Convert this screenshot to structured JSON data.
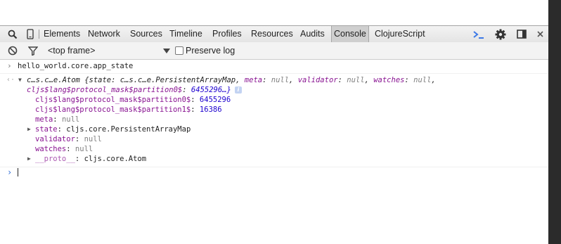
{
  "toolbar": {
    "tabs": [
      "Elements",
      "Network",
      "Sources",
      "Timeline",
      "Profiles",
      "Resources",
      "Audits",
      "Console",
      "ClojureScript"
    ],
    "selected_tab": "Console"
  },
  "filterbar": {
    "frame_selector": "<top frame>",
    "preserve_log_label": "Preserve log",
    "preserve_log_checked": false
  },
  "console": {
    "command": "hello_world.core.app_state",
    "result": {
      "summary_type": "c…s.c…e.Atom ",
      "summary_open": "{state: ",
      "summary_state_type": "c…s.c…e.PersistentArrayMap",
      "summary_meta_key": "meta",
      "summary_meta_val": "null",
      "summary_validator_key": "validator",
      "summary_validator_val": "null",
      "summary_watches_key": "watches",
      "summary_watches_val": "null",
      "summary_mask_key": "cljs$lang$protocol_mask$partition0$",
      "summary_mask_val": "6455296…}",
      "info_icon": "i",
      "props": [
        {
          "key": "cljs$lang$protocol_mask$partition0$",
          "value": "6455296",
          "value_kind": "number",
          "expandable": false
        },
        {
          "key": "cljs$lang$protocol_mask$partition1$",
          "value": "16386",
          "value_kind": "number",
          "expandable": false
        },
        {
          "key": "meta",
          "value": "null",
          "value_kind": "null",
          "expandable": false
        },
        {
          "key": "state",
          "value": "cljs.core.PersistentArrayMap",
          "value_kind": "object",
          "expandable": true
        },
        {
          "key": "validator",
          "value": "null",
          "value_kind": "null",
          "expandable": false
        },
        {
          "key": "watches",
          "value": "null",
          "value_kind": "null",
          "expandable": false
        },
        {
          "key": "__proto__",
          "value": "cljs.core.Atom",
          "value_kind": "object",
          "expandable": true
        }
      ]
    }
  },
  "colors": {
    "property_key": "#881391",
    "number": "#1c00cf",
    "null": "#808080",
    "prompt": "#2f6dd6",
    "dock_accent": "#3b78e7"
  },
  "icons": {
    "toolbar": [
      "search-icon",
      "device-mode-icon",
      "console-drawer-icon",
      "settings-gear-icon",
      "dock-side-icon",
      "close-icon"
    ],
    "filterbar": [
      "clear-console-icon",
      "filter-icon"
    ]
  }
}
